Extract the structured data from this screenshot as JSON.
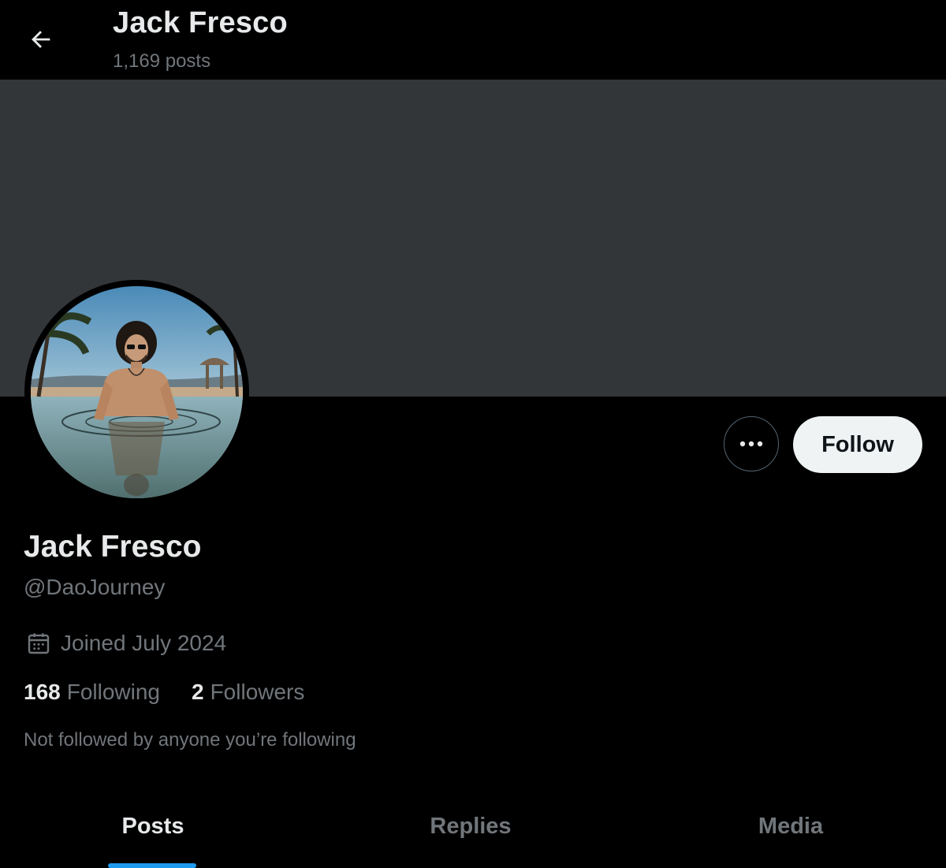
{
  "header": {
    "title": "Jack Fresco",
    "posts_count": "1,169 posts",
    "back_icon": "arrow-left-icon"
  },
  "profile": {
    "display_name": "Jack Fresco",
    "handle": "@DaoJourney",
    "joined": "Joined July 2024",
    "following_count": "168",
    "following_label": "Following",
    "followers_count": "2",
    "followers_label": "Followers",
    "mutuals_text": "Not followed by anyone you’re following"
  },
  "actions": {
    "more_icon": "more-horizontal-icon",
    "follow_label": "Follow"
  },
  "tabs": [
    {
      "label": "Posts",
      "active": true
    },
    {
      "label": "Replies",
      "active": false
    },
    {
      "label": "Media",
      "active": false
    }
  ],
  "colors": {
    "background": "#000000",
    "banner": "#333639",
    "primary_text": "#e7e9ea",
    "secondary_text": "#71767b",
    "accent": "#1d9bf0",
    "follow_button_bg": "#eff3f4"
  }
}
